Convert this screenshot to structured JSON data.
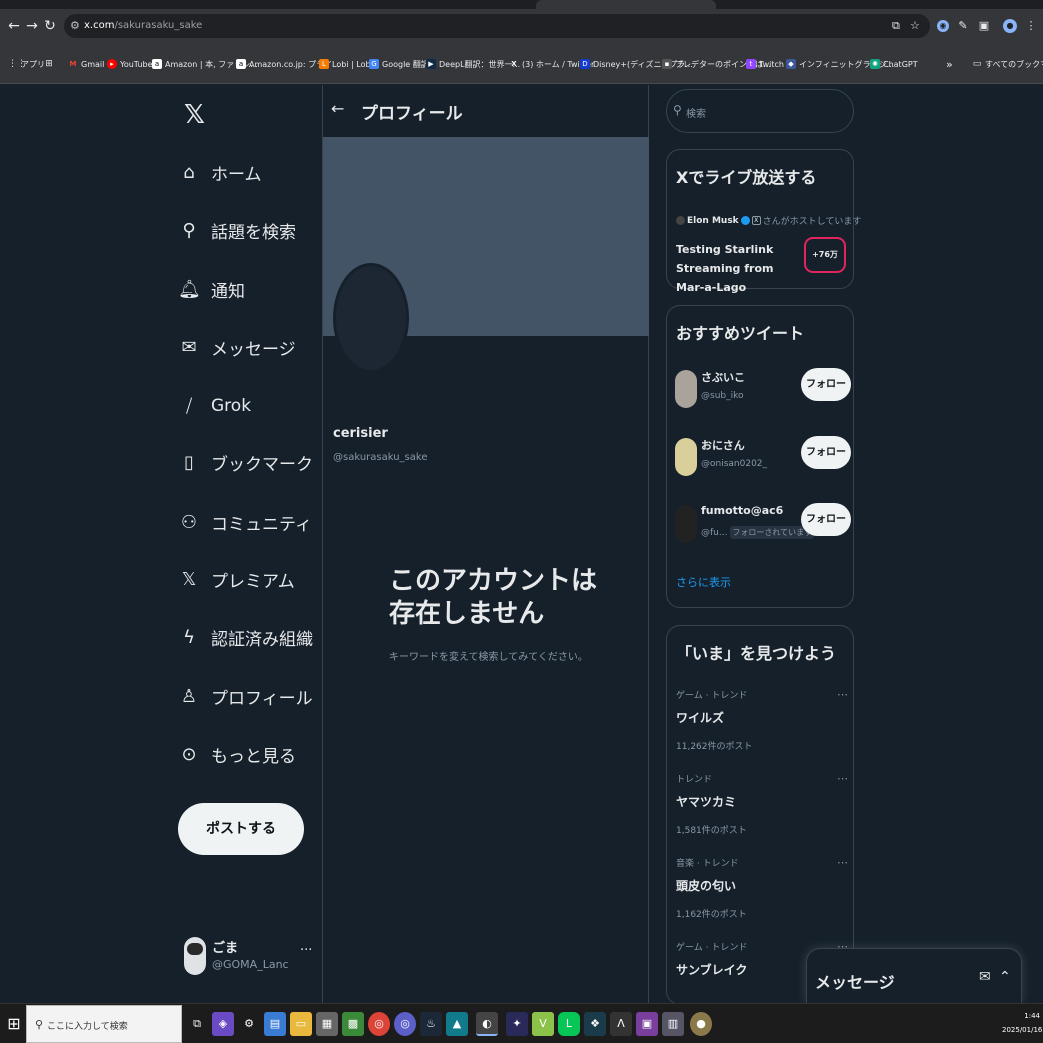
{
  "browser": {
    "url_host": "x.com",
    "url_path": "/sakurasaku_sake",
    "bookmarks": [
      "アプリ",
      "Gmail",
      "YouTube",
      "Amazon | 本, ファッシ...",
      "Amazon.co.jp: プライ...",
      "Lobi | Lobi",
      "Google 翻訳",
      "DeepL翻訳：世界一...",
      "(3) ホーム / Twitter",
      "Disney+(ディズニープラ...",
      "ブレデターのポイントは...",
      "Twitch",
      "インフィニットグランジ...",
      "ChatGPT"
    ],
    "all_bookmarks": "すべてのブックマーク",
    "overflow": "»"
  },
  "nav": {
    "items": [
      "ホーム",
      "話題を検索",
      "通知",
      "メッセージ",
      "Grok",
      "ブックマーク",
      "コミュニティ",
      "プレミアム",
      "認証済み組織",
      "プロフィール",
      "もっと見る"
    ],
    "post_button": "ポストする"
  },
  "account": {
    "name": "ごま",
    "handle": "@GOMA_Lanc",
    "more": "..."
  },
  "profile": {
    "header_title": "プロフィール",
    "name": "cerisier",
    "handle": "@sakurasaku_sake",
    "not_exist_title": "このアカウントは存在しません",
    "not_exist_sub": "キーワードを変えて検索してみてください。"
  },
  "search": {
    "placeholder": "検索"
  },
  "live": {
    "title": "Xでライブ放送する",
    "host_name": "Elon Musk",
    "host_suffix": "さんがホストしています",
    "stream_title": "Testing Starlink Streaming from Mar-a-Lago",
    "listeners": "+76万"
  },
  "recommend": {
    "title": "おすすめツイート",
    "users": [
      {
        "name": "さぶいこ",
        "handle": "@sub_iko",
        "button": "フォロー"
      },
      {
        "name": "おにさん",
        "handle": "@onisan0202_",
        "button": "フォロー"
      },
      {
        "name": "fumotto@ac6",
        "handle": "@fu...",
        "tag": "フォローされています",
        "button": "フォロー"
      }
    ],
    "show_more": "さらに表示"
  },
  "trends": {
    "title": "「いま」を見つけよう",
    "items": [
      {
        "context": "ゲーム · トレンド",
        "keyword": "ワイルズ",
        "posts": "11,262件のポスト"
      },
      {
        "context": "トレンド",
        "keyword": "ヤマツカミ",
        "posts": "1,581件のポスト"
      },
      {
        "context": "音楽 · トレンド",
        "keyword": "頭皮の匂い",
        "posts": "1,162件のポスト"
      },
      {
        "context": "ゲーム · トレンド",
        "keyword": "サンブレイク",
        "posts": ""
      }
    ]
  },
  "messages_dock": {
    "title": "メッセージ"
  },
  "taskbar": {
    "search_placeholder": "ここに入力して検索",
    "time": "1:44",
    "date": "2025/01/16"
  }
}
